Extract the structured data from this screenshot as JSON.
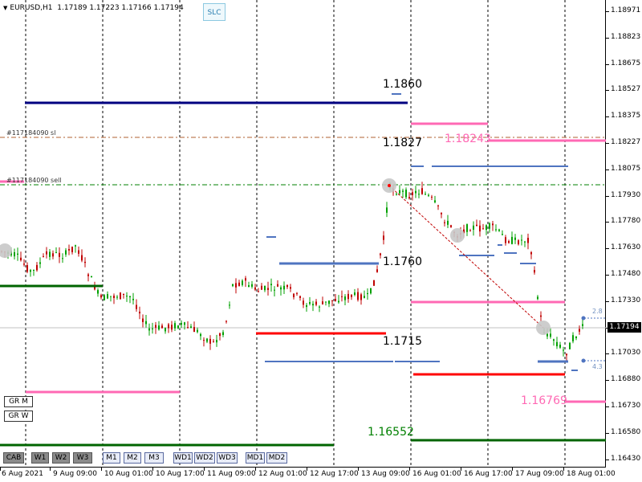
{
  "header": {
    "symbol": "EURUSD,H1",
    "ohlc": "1.17189 1.17223 1.17166 1.17194"
  },
  "slc_label": "SLC",
  "price_axis": {
    "labels": [
      "1.18971",
      "1.18823",
      "1.18675",
      "1.18527",
      "1.18375",
      "1.18227",
      "1.18075",
      "1.17930",
      "1.17780",
      "1.17630",
      "1.17480",
      "1.17330",
      "1.17180",
      "1.17030",
      "1.16880",
      "1.16730",
      "1.16580",
      "1.16430"
    ],
    "current_price": "1.17194"
  },
  "time_axis": {
    "labels": [
      "6 Aug 2021",
      "9 Aug 09:00",
      "10 Aug 01:00",
      "10 Aug 17:00",
      "11 Aug 09:00",
      "12 Aug 01:00",
      "12 Aug 17:00",
      "13 Aug 09:00",
      "16 Aug 01:00",
      "16 Aug 17:00",
      "17 Aug 09:00",
      "18 Aug 01:00"
    ]
  },
  "order_labels": {
    "sl": "#117184090 sl",
    "sell": "#117184090 sell"
  },
  "levels": {
    "l1860": "1.1860",
    "l1827": "1.1827",
    "l18243": "1.18243",
    "l1760": "1.1760",
    "l1715": "1.1715",
    "l16769": "1.16769",
    "l16552": "1.16552",
    "r28": "2.8",
    "r43": "4.3"
  },
  "buttons_top": {
    "grm": "GR M",
    "grw": "GR W"
  },
  "buttons_bottom": [
    "CAB",
    "W1",
    "W2",
    "W3",
    "M1",
    "M2",
    "M3",
    "WD1",
    "WD2",
    "WD3",
    "MD1",
    "MD2"
  ],
  "colors": {
    "navy": "#000080",
    "pink": "#ff69b4",
    "blue": "#4f74c0",
    "red": "#ff0000",
    "green": "#006400",
    "bull": "#00a000",
    "bear": "#c00000"
  }
}
